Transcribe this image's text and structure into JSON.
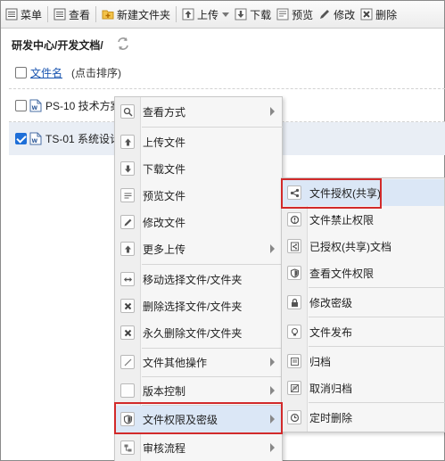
{
  "toolbar": {
    "menu": "菜单",
    "view": "查看",
    "new_folder": "新建文件夹",
    "upload": "上传",
    "download": "下载",
    "preview": "预览",
    "modify": "修改",
    "delete": "删除"
  },
  "path": "研发中心/开发文档/",
  "list": {
    "header_link": "文件名",
    "header_hint": "(点击排序)",
    "files": [
      {
        "name": "PS-10 技术方案",
        "checked": false
      },
      {
        "name": "TS-01 系统设计",
        "checked": true
      }
    ]
  },
  "context_menu": {
    "items": [
      {
        "label": "查看方式",
        "icon": "magnifier-icon",
        "submenu": true
      },
      {
        "label": "上传文件",
        "icon": "upload-icon",
        "submenu": false
      },
      {
        "label": "下载文件",
        "icon": "download-icon",
        "submenu": false
      },
      {
        "label": "预览文件",
        "icon": "preview-icon",
        "submenu": false
      },
      {
        "label": "修改文件",
        "icon": "pencil-icon",
        "submenu": false
      },
      {
        "label": "更多上传",
        "icon": "upload-more-icon",
        "submenu": true
      },
      {
        "label": "移动选择文件/文件夹",
        "icon": "move-icon",
        "submenu": false
      },
      {
        "label": "删除选择文件/文件夹",
        "icon": "delete-x-icon",
        "submenu": false
      },
      {
        "label": "永久删除文件/文件夹",
        "icon": "delete-x-icon",
        "submenu": false
      },
      {
        "label": "文件其他操作",
        "icon": "slash-icon",
        "submenu": true
      },
      {
        "label": "版本控制",
        "icon": "blank-icon",
        "submenu": true
      },
      {
        "label": "文件权限及密级",
        "icon": "shield-icon",
        "submenu": true
      },
      {
        "label": "审核流程",
        "icon": "flow-icon",
        "submenu": true
      }
    ]
  },
  "sub_menu": {
    "items": [
      {
        "label": "文件授权(共享)",
        "icon": "share-icon"
      },
      {
        "label": "文件禁止权限",
        "icon": "forbid-icon"
      },
      {
        "label": "已授权(共享)文档",
        "icon": "share-doc-icon"
      },
      {
        "label": "查看文件权限",
        "icon": "shield-icon"
      },
      {
        "label": "修改密级",
        "icon": "lock-icon"
      },
      {
        "label": "文件发布",
        "icon": "bulb-icon"
      },
      {
        "label": "归档",
        "icon": "archive-icon"
      },
      {
        "label": "取消归档",
        "icon": "unarchive-icon"
      },
      {
        "label": "定时删除",
        "icon": "clock-icon"
      }
    ]
  },
  "colors": {
    "highlight_box": "#d22a2a",
    "hover_bg": "#dbe7f6",
    "link": "#1a55b0",
    "checkbox_checked": "#1e6fd8"
  }
}
